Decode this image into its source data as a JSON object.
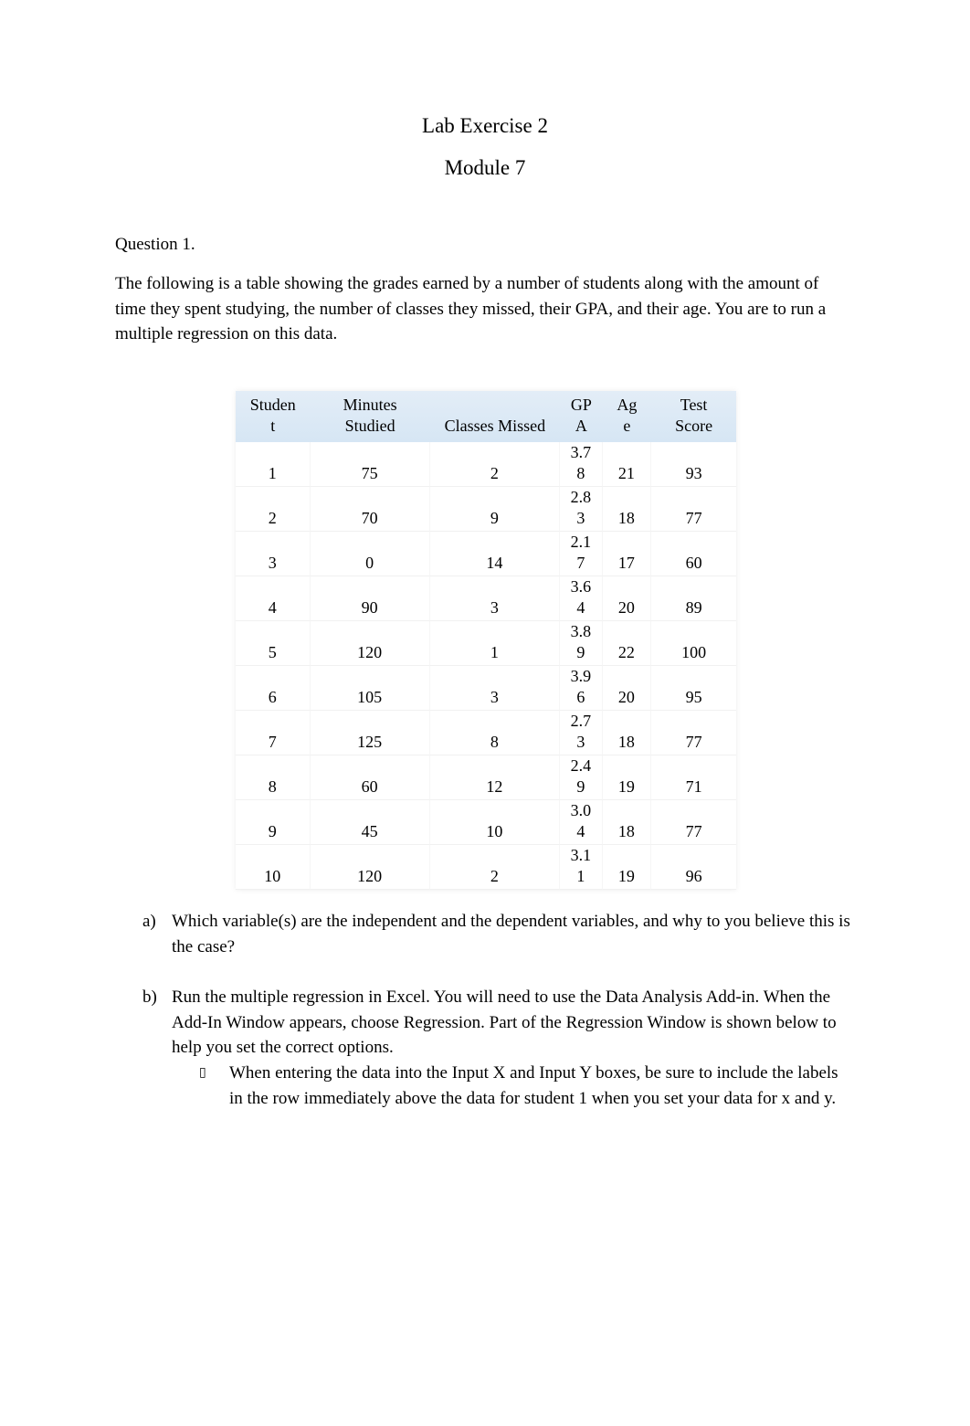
{
  "document": {
    "title": "Lab Exercise 2",
    "subtitle": "Module 7",
    "question_label": "Question 1.",
    "intro": "The following is a table showing the grades earned by a number of students along with the amount of time they spent studying, the number of classes they missed, their GPA, and their age. You are to run a multiple regression on this data."
  },
  "table": {
    "headers": [
      "Studen t",
      "Minutes Studied",
      "Classes Missed",
      "GP A",
      "Ag e",
      "Test Score"
    ],
    "header_lines": [
      [
        "Studen",
        "t"
      ],
      [
        "Minutes",
        "Studied"
      ],
      [
        "Classes Missed"
      ],
      [
        "GP",
        "A"
      ],
      [
        "Ag",
        "e"
      ],
      [
        "Test",
        "Score"
      ]
    ],
    "rows": [
      {
        "student": "1",
        "minutes": "75",
        "classes": "2",
        "gpa_a": "3.7",
        "gpa_b": "8",
        "age": "21",
        "score": "93"
      },
      {
        "student": "2",
        "minutes": "70",
        "classes": "9",
        "gpa_a": "2.8",
        "gpa_b": "3",
        "age": "18",
        "score": "77"
      },
      {
        "student": "3",
        "minutes": "0",
        "classes": "14",
        "gpa_a": "2.1",
        "gpa_b": "7",
        "age": "17",
        "score": "60"
      },
      {
        "student": "4",
        "minutes": "90",
        "classes": "3",
        "gpa_a": "3.6",
        "gpa_b": "4",
        "age": "20",
        "score": "89"
      },
      {
        "student": "5",
        "minutes": "120",
        "classes": "1",
        "gpa_a": "3.8",
        "gpa_b": "9",
        "age": "22",
        "score": "100"
      },
      {
        "student": "6",
        "minutes": "105",
        "classes": "3",
        "gpa_a": "3.9",
        "gpa_b": "6",
        "age": "20",
        "score": "95"
      },
      {
        "student": "7",
        "minutes": "125",
        "classes": "8",
        "gpa_a": "2.7",
        "gpa_b": "3",
        "age": "18",
        "score": "77"
      },
      {
        "student": "8",
        "minutes": "60",
        "classes": "12",
        "gpa_a": "2.4",
        "gpa_b": "9",
        "age": "19",
        "score": "71"
      },
      {
        "student": "9",
        "minutes": "45",
        "classes": "10",
        "gpa_a": "3.0",
        "gpa_b": "4",
        "age": "18",
        "score": "77"
      },
      {
        "student": "10",
        "minutes": "120",
        "classes": "2",
        "gpa_a": "3.1",
        "gpa_b": "1",
        "age": "19",
        "score": "96"
      }
    ]
  },
  "questions": [
    {
      "marker": "a)",
      "text": "Which variable(s) are the independent and the dependent variables, and why to you believe this is the case?"
    },
    {
      "marker": "b)",
      "text": "Run the multiple regression in Excel. You will need to use the Data Analysis Add-in. When the Add-In Window appears, choose Regression. Part of the Regression Window is shown below to help you set the correct options."
    }
  ],
  "bullets": [
    {
      "icon": "missing-glyph-icon",
      "glyph": "▯",
      "text": "When entering the data into the Input X and Input Y boxes, be sure to include the labels in the row immediately above the data for student 1 when you set your data for x and y."
    }
  ],
  "colors": {
    "header_bg": "#dce9f5",
    "text": "#000000"
  }
}
